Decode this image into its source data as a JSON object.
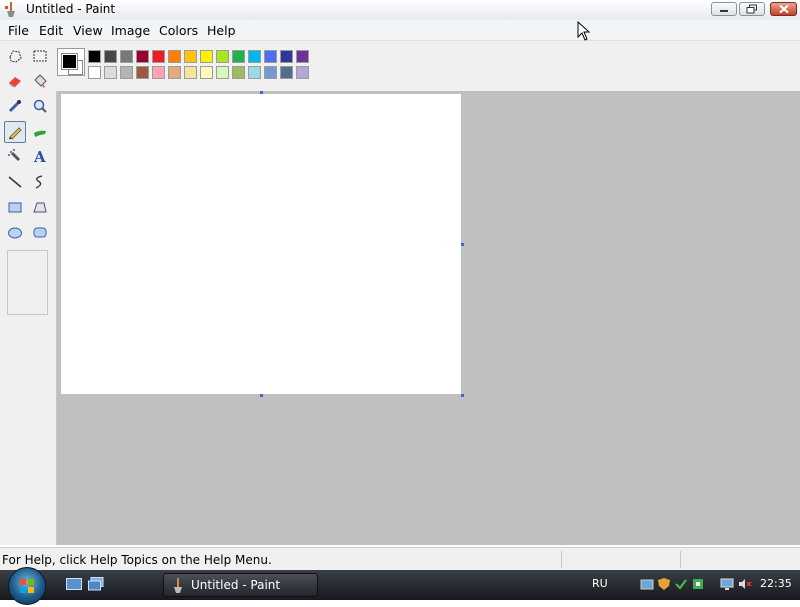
{
  "window": {
    "title": "Untitled - Paint"
  },
  "menu": {
    "items": [
      {
        "label": "File"
      },
      {
        "label": "Edit"
      },
      {
        "label": "View"
      },
      {
        "label": "Image"
      },
      {
        "label": "Colors"
      },
      {
        "label": "Help"
      }
    ]
  },
  "toolbox": {
    "selected_tool": "pencil-icon",
    "tools": [
      "free-form-select-icon",
      "select-icon",
      "eraser-icon",
      "fill-icon",
      "color-picker-icon",
      "magnifier-icon",
      "pencil-icon",
      "brush-icon",
      "airbrush-icon",
      "text-icon",
      "line-icon",
      "curve-icon",
      "rectangle-icon",
      "polygon-icon",
      "ellipse-icon",
      "rounded-rectangle-icon"
    ]
  },
  "palette": {
    "foreground": "#000000",
    "background": "#ffffff",
    "top_row": [
      "#000000",
      "#464646",
      "#787878",
      "#990030",
      "#ed1c24",
      "#ff7e00",
      "#ffc20e",
      "#fff200",
      "#a8e61d",
      "#22b14c",
      "#00b7ef",
      "#4d6df3",
      "#2f3699",
      "#6f3198"
    ],
    "bottom_row": [
      "#ffffff",
      "#dcdcdc",
      "#b4b4b4",
      "#9c5a3c",
      "#ffa3b1",
      "#e5aa7a",
      "#f5e49c",
      "#fff9bd",
      "#d3f9bc",
      "#9dbb61",
      "#99d9ea",
      "#709ad1",
      "#546d8e",
      "#b5a5d5"
    ]
  },
  "statusbar": {
    "help_text": "For Help, click Help Topics on the Help Menu."
  },
  "taskbar": {
    "task_label": "Untitled - Paint",
    "language": "RU",
    "clock": "22:35"
  }
}
